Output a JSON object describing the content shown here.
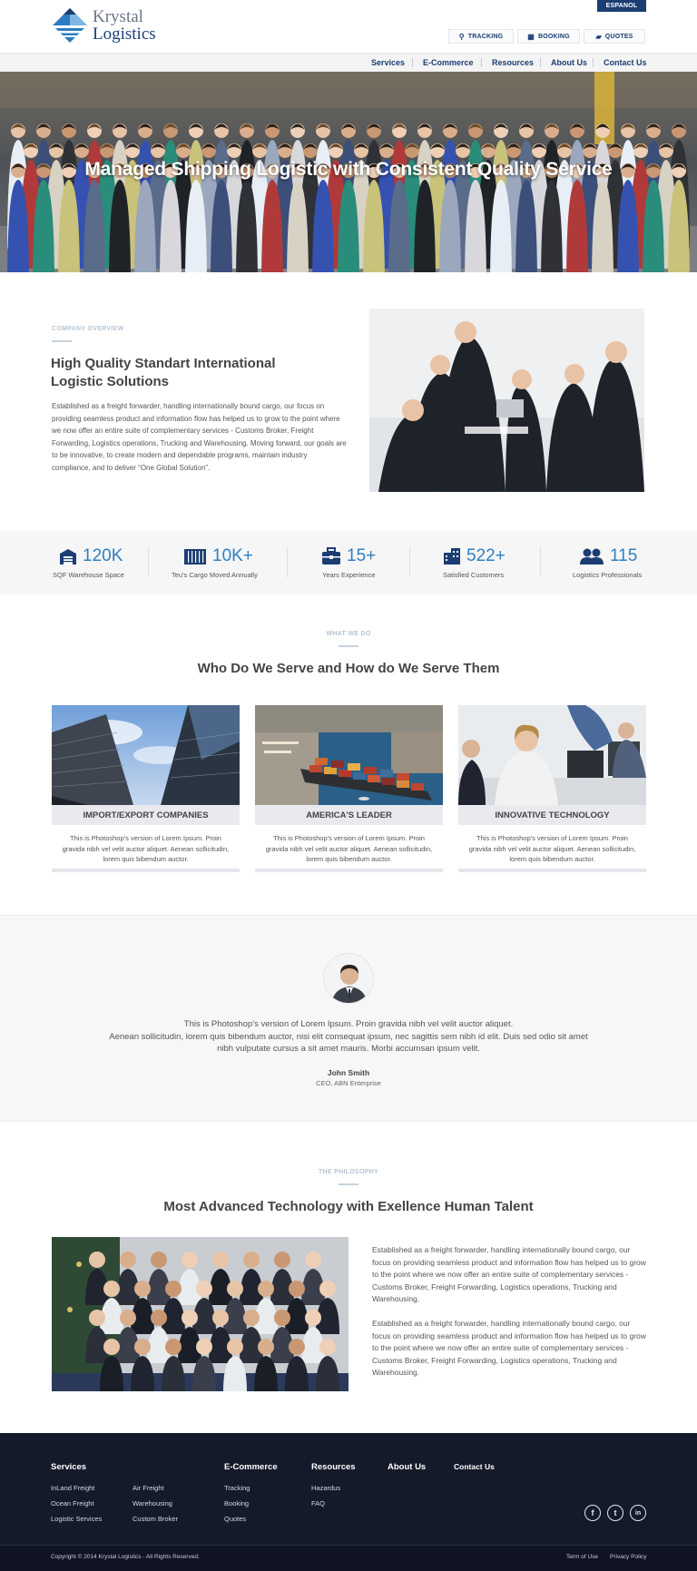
{
  "header": {
    "logo_line1": "Krystal",
    "logo_line2": "Logistics",
    "espanol": "ESPANOL",
    "quick_buttons": [
      {
        "label": "TRACKING",
        "icon": "map-pin-icon"
      },
      {
        "label": "BOOKING",
        "icon": "calendar-icon"
      },
      {
        "label": "QUOTES",
        "icon": "chat-icon"
      }
    ],
    "nav": [
      "Services",
      "E-Commerce",
      "Resources",
      "About Us",
      "Contact Us"
    ]
  },
  "hero": {
    "title": "Managed Shipping Logistic with Consistent Quality Service"
  },
  "overview": {
    "eyebrow": "COMPANY OVERVIEW",
    "title_line1": "High Quality Standart International",
    "title_line2": "Logistic Solutions",
    "body": "Established as a freight forwarder, handling internationally bound cargo, our focus on providing seamless product and information flow has helped us to grow to the point where we now offer an entire suite of complementary services - Customs Broker, Freight Forwarding, Logistics operations, Trucking and Warehousing. Moving forward, our goals are to be innovative, to create modern and dependable programs, maintain industry compliance, and to deliver “One Global Solution”."
  },
  "stats": [
    {
      "value": "120K",
      "label": "SQF Warehouse Space",
      "icon": "warehouse-icon"
    },
    {
      "value": "10K+",
      "label": "Teu's Cargo Moved Annually",
      "icon": "container-icon"
    },
    {
      "value": "15+",
      "label": "Years Experience",
      "icon": "briefcase-icon"
    },
    {
      "value": "522+",
      "label": "Satisfied Customers",
      "icon": "buildings-icon"
    },
    {
      "value": "115",
      "label": "Logistics Professionals",
      "icon": "people-icon"
    }
  ],
  "what_we_do": {
    "eyebrow": "WHAT WE DO",
    "title": "Who Do We Serve and How do We Serve Them",
    "cards": [
      {
        "title": "IMPORT/EXPORT COMPANIES",
        "text": "This is Photoshop's version of Lorem Ipsum. Proin gravida nibh vel velit auctor aliquet. Aenean sollicitudin, lorem quis bibendum auctor."
      },
      {
        "title": "AMERICA'S LEADER",
        "text": "This is Photoshop's version of Lorem Ipsum. Proin gravida nibh vel velit auctor aliquet. Aenean sollicitudin, lorem quis bibendum auctor."
      },
      {
        "title": "INNOVATIVE TECHNOLOGY",
        "text": "This is Photoshop's version of Lorem Ipsum. Proin gravida nibh vel velit auctor aliquet. Aenean sollicitudin, lorem quis bibendum auctor."
      }
    ]
  },
  "testimonial": {
    "quote_line1": "This is Photoshop's version of Lorem Ipsum. Proin gravida nibh vel velit auctor aliquet.",
    "quote_line2": "Aenean sollicitudin, lorem quis bibendum auctor, nisi elit consequat ipsum, nec sagittis sem nibh id elit. Duis sed odio sit amet",
    "quote_line3": "nibh vulputate cursus a sit amet mauris. Morbi accumsan ipsum velit.",
    "name": "John Smith",
    "role": "CEO, ABN Enterprise"
  },
  "philosophy": {
    "eyebrow": "THE PHILOSOPHY",
    "title": "Most Advanced Technology with Exellence Human Talent",
    "para1": "Established as a freight forwarder, handling internationally bound cargo, our focus on providing seamless product and information flow has helped us to grow to the point where we now offer an entire suite of complementary services - Customs Broker, Freight Forwarding, Logistics operations, Trucking and Warehousing.",
    "para2": "Established as a freight forwarder, handling internationally bound cargo, our focus on providing seamless product and information flow has helped us to grow to the point where we now offer an entire suite of complementary services - Customs Broker, Freight Forwarding, Logistics operations, Trucking and Warehousing."
  },
  "footer": {
    "services": {
      "heading": "Services",
      "col1": [
        "InLand Freight",
        "Ocean Freight",
        "Logistic Services"
      ],
      "col2": [
        "Air Freight",
        "Warehousing",
        "Custom Broker"
      ]
    },
    "ecommerce": {
      "heading": "E-Commerce",
      "links": [
        "Tracking",
        "Booking",
        "Quotes"
      ]
    },
    "resources": {
      "heading": "Resources",
      "links": [
        "Hazardus",
        "FAQ"
      ]
    },
    "about": {
      "heading": "About Us"
    },
    "contact": {
      "heading": "Contact Us"
    },
    "social": [
      {
        "glyph": "f",
        "icon": "facebook-icon"
      },
      {
        "glyph": "t",
        "icon": "twitter-icon"
      },
      {
        "glyph": "in",
        "icon": "linkedin-icon"
      }
    ],
    "copyright": "Copyright © 2014 Krystal Logistics - All Rights Reserved.",
    "terms": "Term of Use",
    "privacy": "Privacy Policy"
  },
  "colors": {
    "brand_navy": "#1b3d72",
    "accent_blue": "#2f7fc1",
    "footer_bg": "#151a2b"
  }
}
